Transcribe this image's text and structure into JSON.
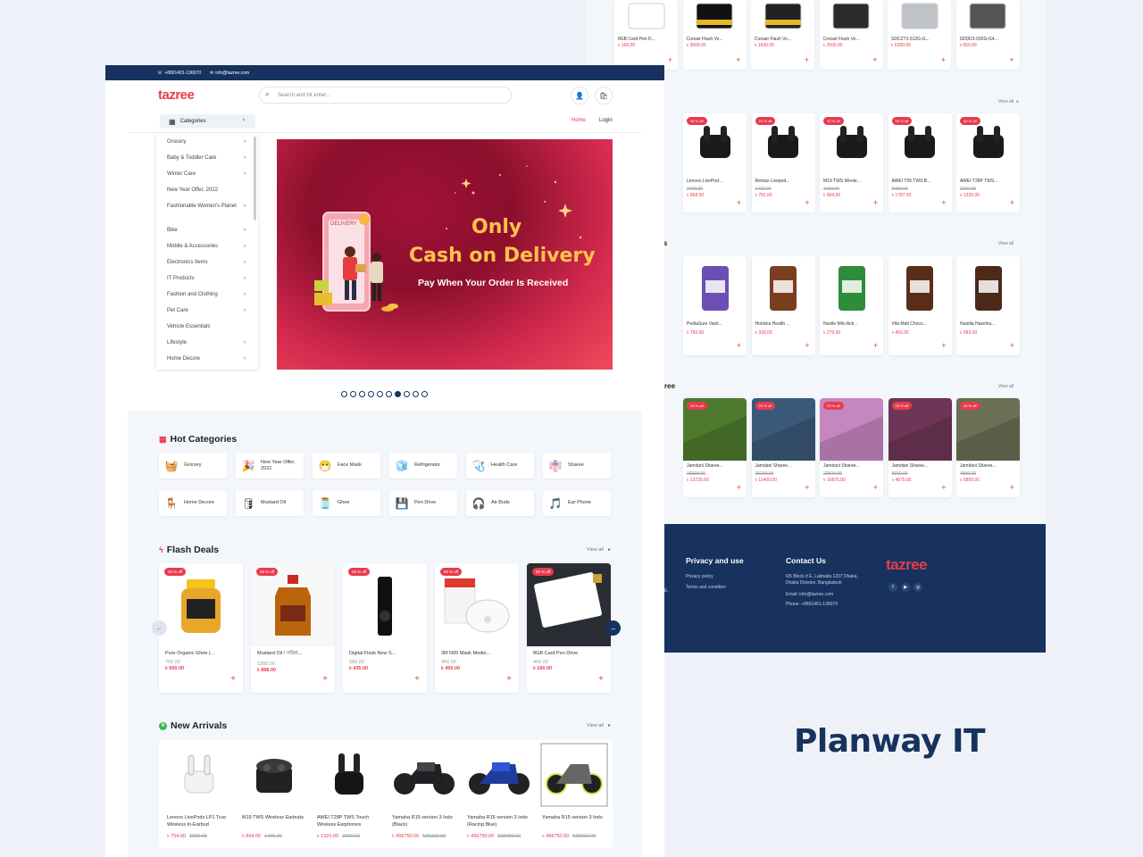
{
  "brand": "Planway IT",
  "colors": {
    "accent": "#e83b4e",
    "navy": "#17325e",
    "bg": "#eef2f8"
  },
  "topbar": {
    "phone": "+8801401-136070",
    "email": "info@tazree.com"
  },
  "header": {
    "logo": "tazree",
    "search_placeholder": "Search and hit enter...",
    "categories_label": "Categories",
    "nav_home": "Home",
    "nav_login": "Login"
  },
  "sidebar": {
    "items": [
      {
        "label": "Grocery",
        "chevron": true
      },
      {
        "label": "Baby & Toddler Care",
        "chevron": true
      },
      {
        "label": "Winter Care",
        "chevron": true
      },
      {
        "label": "New Year Offer, 2022",
        "chevron": false
      },
      {
        "label": "Fashionable Women's Planet",
        "chevron": true
      },
      {
        "label": "Bike",
        "chevron": true
      },
      {
        "label": "Mobile & Accessories",
        "chevron": true
      },
      {
        "label": "Electronics Items",
        "chevron": true
      },
      {
        "label": "IT Products",
        "chevron": true
      },
      {
        "label": "Fashion and Clothing",
        "chevron": true
      },
      {
        "label": "Pet Care",
        "chevron": true
      },
      {
        "label": "Vehicle Essentials",
        "chevron": false
      },
      {
        "label": "Lifestyle",
        "chevron": true
      },
      {
        "label": "Home Decore",
        "chevron": true
      }
    ]
  },
  "banner": {
    "line1": "Only",
    "line2": "Cash on Delivery",
    "line3": "Pay When Your Order Is Received",
    "phone_text": "DELIVERY",
    "slides": 10,
    "active_slide": 7
  },
  "hot_categories": {
    "title": "Hot Categories",
    "items": [
      {
        "label": "Grocery",
        "icon": "grocery-basket-icon",
        "glyph": "🧺"
      },
      {
        "label": "New Year Offer, 2022",
        "icon": "new-year-icon",
        "glyph": "🎉"
      },
      {
        "label": "Face Mask",
        "icon": "face-mask-icon",
        "glyph": "😷"
      },
      {
        "label": "Refrigerator",
        "icon": "refrigerator-icon",
        "glyph": "🧊"
      },
      {
        "label": "Health Care",
        "icon": "stethoscope-icon",
        "glyph": "🩺"
      },
      {
        "label": "Sharee",
        "icon": "sharee-icon",
        "glyph": "👘"
      },
      {
        "label": "Home Decore",
        "icon": "home-decor-icon",
        "glyph": "🪑"
      },
      {
        "label": "Mustard Oil",
        "icon": "oil-icon",
        "glyph": "🛢"
      },
      {
        "label": "Ghee",
        "icon": "ghee-jar-icon",
        "glyph": "🫙"
      },
      {
        "label": "Pen Drive",
        "icon": "pen-drive-icon",
        "glyph": "💾"
      },
      {
        "label": "Air Buds",
        "icon": "air-buds-icon",
        "glyph": "🎧"
      },
      {
        "label": "Ear Phone",
        "icon": "ear-phone-icon",
        "glyph": "🎵"
      }
    ]
  },
  "flash_deals": {
    "title": "Flash Deals",
    "view_all": "View all",
    "items": [
      {
        "name": "Pure Organic Ghee (...",
        "old": "750.00",
        "price": "৳ 600.00",
        "badge": "20 % off",
        "icon": "ghee-jar-image"
      },
      {
        "name": "Mustard Oil / সরিষা...",
        "old": "1200.00",
        "price": "৳ 888.00",
        "badge": "26 % off",
        "icon": "oil-bottle-image"
      },
      {
        "name": "Digital Flask New S...",
        "old": "580.00",
        "price": "৳ 435.00",
        "badge": "25 % off",
        "icon": "flask-image"
      },
      {
        "name": "3M N95 Mask Model...",
        "old": "900.00",
        "price": "৳ 450.00",
        "badge": "50 % off",
        "icon": "mask-image"
      },
      {
        "name": "8GB Card Pen Drive",
        "old": "400.00",
        "price": "৳ 160.00",
        "badge": "60 % off",
        "icon": "card-drive-image"
      }
    ]
  },
  "new_arrivals": {
    "title": "New Arrivals",
    "view_all": "View all",
    "items": [
      {
        "name": "Lenovo LivePods LP1 True Wireless In-Earbud",
        "price": "৳ 754.00",
        "old": "1300.00"
      },
      {
        "name": "M19 TWS Wireless Earbuds",
        "price": "৳ 894.00",
        "old": "1490.00"
      },
      {
        "name": "AWEI T28P TWS Touch Wireless Earphones",
        "price": "৳ 1320.00",
        "old": "2200.00"
      },
      {
        "name": "Yamaha R15 version 3 Indo (Black)",
        "price": "৳ 456750.00",
        "old": "525000.00"
      },
      {
        "name": "Yamaha R15 version 3 Indo (Racing Blue)",
        "price": "৳ 456750.00",
        "old": "525000.00"
      },
      {
        "name": "Yamaha R15 version 3 Indo",
        "price": "৳ 456750.00",
        "old": "525000.00"
      }
    ]
  },
  "back_page": {
    "row1": [
      {
        "name": "8GB Card Pen D...",
        "price": "৳ 160.00"
      },
      {
        "name": "Corsair Flash Vo...",
        "price": "৳ 3000.00"
      },
      {
        "name": "Corsair Flash Vo...",
        "price": "৳ 1600.00"
      },
      {
        "name": "Corsair Flash Vo...",
        "price": "৳ 2500.00"
      },
      {
        "name": "SDCZ73-512G-G...",
        "price": "৳ 6350.00"
      },
      {
        "name": "SDDD3-032G-G4...",
        "price": "৳ 650.00"
      }
    ],
    "view_all": "View all",
    "row2": [
      {
        "name": "Lenovo LivePod...",
        "old": "1400.00",
        "price": "৳ 868.00",
        "badge": "38 % off"
      },
      {
        "name": "Remax Livepod...",
        "old": "1420.00",
        "price": "৳ 781.00",
        "badge": "45 % off"
      },
      {
        "name": "M19 TWS Wirele...",
        "old": "1490.00",
        "price": "৳ 894.00",
        "badge": "40 % off"
      },
      {
        "name": "AWEI T55 TWS B...",
        "old": "2750.00",
        "price": "৳ 1787.50",
        "badge": "35 % off"
      },
      {
        "name": "AWEI T28P TWS...",
        "old": "2200.00",
        "price": "৳ 1320.00",
        "badge": "40 % off"
      }
    ],
    "row3_title_fragment": "cks",
    "row3": [
      {
        "name": "PediaSure Vanil...",
        "price": "৳ 750.00"
      },
      {
        "name": "Horlicks Health ...",
        "price": "৳ 339.00"
      },
      {
        "name": "Nestle Milo Acti...",
        "price": "৳ 270.00"
      },
      {
        "name": "Vita Malt Choco...",
        "price": "৳ 450.00"
      },
      {
        "name": "Nutella Hazelnu...",
        "price": "৳ 583.00"
      }
    ],
    "row4_title_fragment": "ree",
    "row4": [
      {
        "name": "Jamdani Sharee...",
        "old": "18300.00",
        "price": "৳ 13725.00",
        "badge": "25 % off"
      },
      {
        "name": "Jamdani Sharee...",
        "old": "15200.00",
        "price": "৳ 11400.00",
        "badge": "25 % off"
      },
      {
        "name": "Jamdani Sharee...",
        "old": "22500.00",
        "price": "৳ 16875.00",
        "badge": "25 % off"
      },
      {
        "name": "Jamdani Sharee...",
        "old": "6500.00",
        "price": "৳ 4875.00",
        "badge": "25 % off"
      },
      {
        "name": "Jamdani Sharee...",
        "old": "7800.00",
        "price": "৳ 5850.00",
        "badge": "25 % off"
      }
    ],
    "footer": {
      "col1_title": "Privacy and use",
      "col1_links": [
        "Privacy policy",
        "Terms and condition"
      ],
      "col2_title": "Contact Us",
      "address": "6/5 Block # E, Lalmatia 1207 Dhaka, Dhaka Division, Bangladesh",
      "email": "Email: info@tazree.com",
      "phone": "Phone: +8801401-136070",
      "logo": "tazree",
      "left_fragment": "E."
    }
  }
}
